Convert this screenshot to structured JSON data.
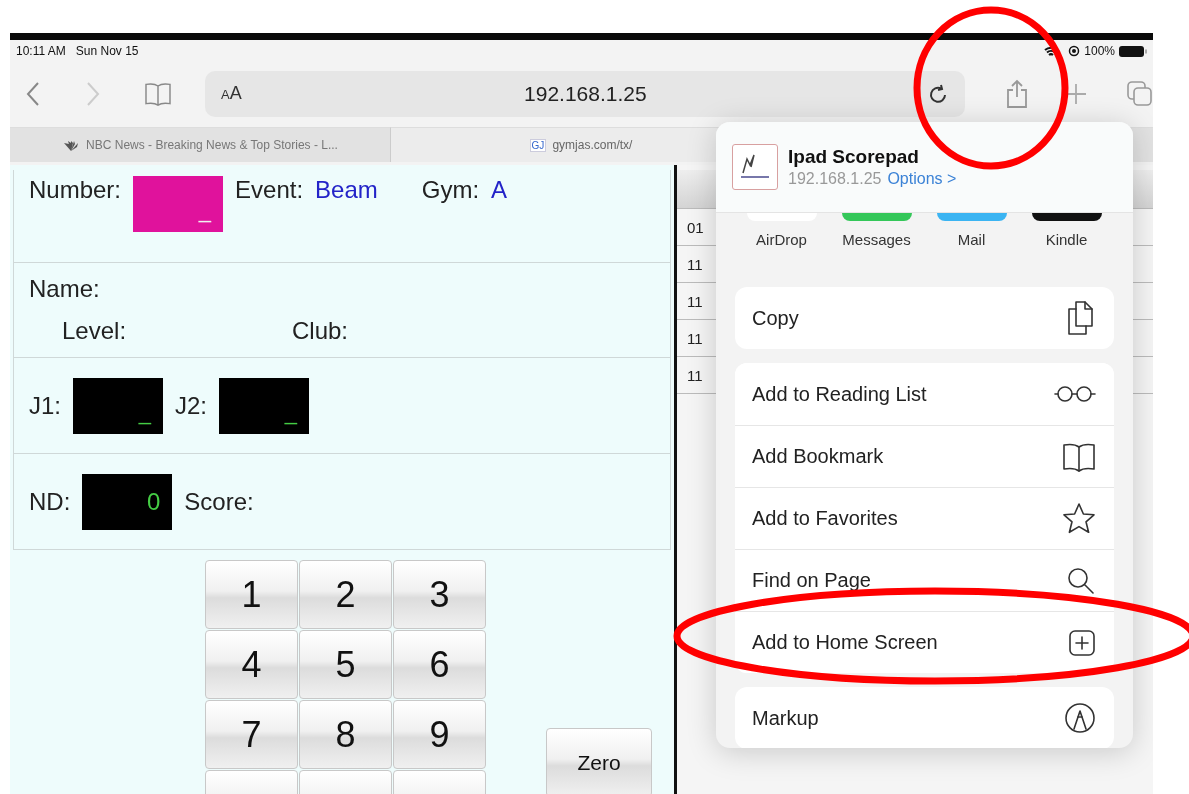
{
  "status_bar": {
    "time": "10:11 AM",
    "date": "Sun Nov 15",
    "battery": "100%"
  },
  "toolbar": {
    "text_size": "AA",
    "url": "192.168.1.25"
  },
  "tabs": [
    {
      "title": "NBC News - Breaking News & Top Stories - L...",
      "selected": false
    },
    {
      "title": "gymjas.com/tx/",
      "favicon": "GJ",
      "selected": true
    }
  ],
  "form": {
    "number_label": "Number:",
    "number_value": "_",
    "event_label": "Event:",
    "event": "Beam",
    "gym_label": "Gym:",
    "gym": "A",
    "name_label": "Name:",
    "level_label": "Level:",
    "club_label": "Club:",
    "j1_label": "J1:",
    "j1": "_",
    "j2_label": "J2:",
    "j2": "_",
    "nd_label": "ND:",
    "nd": "0",
    "score_label": "Score:"
  },
  "keypad": {
    "keys": [
      "1",
      "2",
      "3",
      "4",
      "5",
      "6",
      "7",
      "8",
      "9"
    ],
    "zero": "Zero"
  },
  "background_list": {
    "rows": [
      {
        "column_1": "01"
      },
      {
        "column_1": "11"
      },
      {
        "column_1": "11"
      },
      {
        "column_1": "11"
      },
      {
        "column_1": "11"
      }
    ]
  },
  "share_sheet": {
    "app": {
      "title": "Ipad Scorepad",
      "url": "192.168.1.25",
      "options": "Options >"
    },
    "targets": [
      {
        "label": "AirDrop",
        "color": "#ffffff"
      },
      {
        "label": "Messages",
        "color": "#34c759"
      },
      {
        "label": "Mail",
        "color": "#3bb4f2"
      },
      {
        "label": "Kindle",
        "color": "#111111"
      }
    ],
    "groups": [
      [
        {
          "label": "Copy",
          "kind": "copy"
        }
      ],
      [
        {
          "label": "Add to Reading List",
          "kind": "glasses"
        },
        {
          "label": "Add Bookmark",
          "kind": "book"
        },
        {
          "label": "Add to Favorites",
          "kind": "star"
        },
        {
          "label": "Find on Page",
          "kind": "search"
        },
        {
          "label": "Add to Home Screen",
          "kind": "add-square"
        }
      ],
      [
        {
          "label": "Markup",
          "kind": "markup"
        }
      ]
    ]
  }
}
